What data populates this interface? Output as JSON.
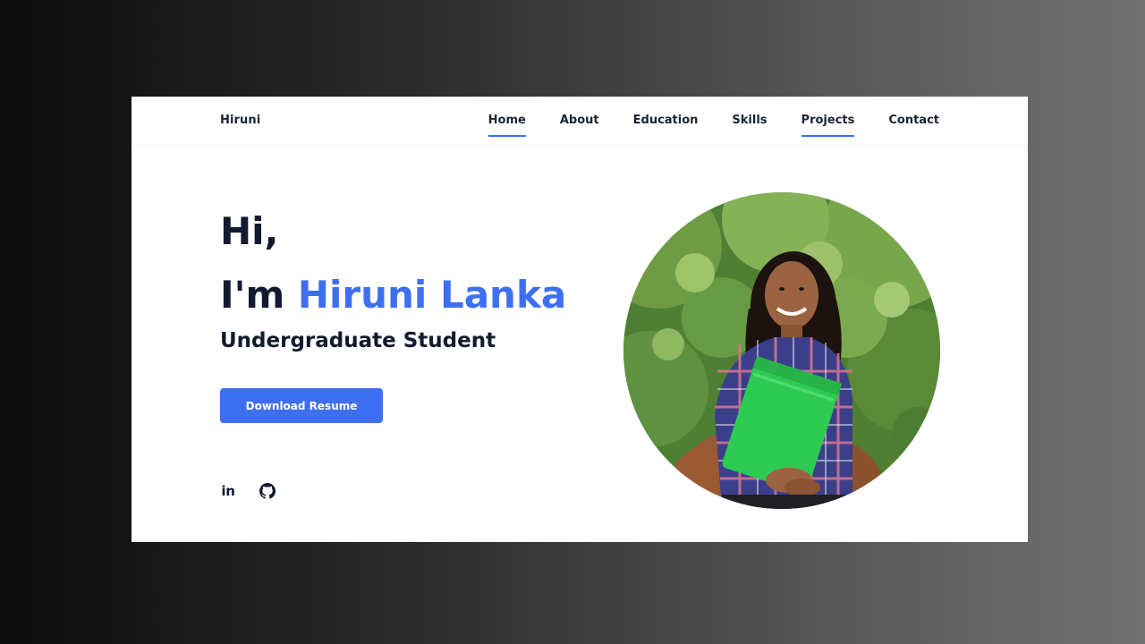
{
  "navbar": {
    "logo": "Hiruni",
    "links": [
      {
        "label": "Home",
        "active": true
      },
      {
        "label": "About",
        "active": false
      },
      {
        "label": "Education",
        "active": false
      },
      {
        "label": "Skills",
        "active": false
      },
      {
        "label": "Projects",
        "active": true
      },
      {
        "label": "Contact",
        "active": false
      }
    ]
  },
  "hero": {
    "greeting": "Hi,",
    "intro_prefix": "I'm ",
    "name": "Hiruni Lanka",
    "role": "Undergraduate Student",
    "resume_button": "Download Resume"
  },
  "social": {
    "linkedin_icon": "in",
    "github_icon": "github-icon"
  },
  "colors": {
    "accent": "#3f6ff1",
    "heading": "#111a2e",
    "background_gradient": [
      "#0c0c0c",
      "#717171"
    ]
  }
}
